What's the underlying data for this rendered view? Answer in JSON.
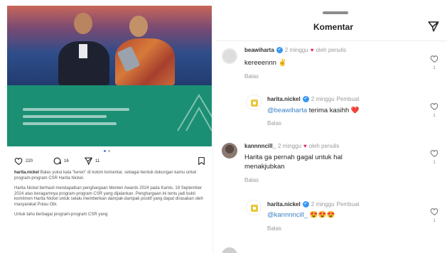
{
  "post": {
    "likes": "220",
    "comments": "16",
    "shares": "11",
    "caption_user": "harita.nickel",
    "caption_line1": "Balas yukui kata \"keren\" di kolom komentar, sebagai bentuk dukungan kamu untuk program-program CSR Harita Nickel.",
    "caption_p2": "Harita Nickel berhasil mendapatkan penghargaan Menteri Awards 2024 pada Kamis, 19 September 2024 atas beragamnya program-program CSR yang dijalankan. Penghargaan ini tentu jadi bukti komitmen Harita Nickel untuk selalu memberikan dampak-dampak positif yang dapat dirasakan oleh masyarakat Pulau Obi.",
    "caption_p3": "Untuk tahu berbagai program-program CSR yang"
  },
  "sheet": {
    "title": "Komentar"
  },
  "comments": [
    {
      "user": "beawiharta",
      "time": "2 minggu",
      "liked_by": "oleh penulis",
      "text": "kereeennn",
      "emoji": "✌️",
      "reply": "Balas",
      "likes": "1"
    },
    {
      "user": "harita.nickel",
      "time": "2 minggu",
      "tag": "Pembuat",
      "mention": "@beawiharta",
      "text": " terima kasihh",
      "emoji": "❤️",
      "reply": "Balas",
      "likes": "1"
    },
    {
      "user": "kannnncill_",
      "time": "2 minggu",
      "liked_by": "oleh penulis",
      "text": "Harita ga pernah gagal untuk hal menakjubkan",
      "reply": "Balas",
      "likes": "1"
    },
    {
      "user": "harita.nickel",
      "time": "2 minggu",
      "tag": "Pembuat",
      "mention": "@kannnncill_",
      "text": " ",
      "emoji": "😍😍😍",
      "reply": "Balas",
      "likes": "1"
    }
  ],
  "icons": {
    "like": "heart-icon",
    "comment": "comment-icon",
    "share": "send-icon",
    "save": "bookmark-icon",
    "verified": "verified-badge-icon"
  },
  "colors": {
    "accent_blue": "#3897f0",
    "heart_red": "#e0245e",
    "panel_green": "#1b8f73"
  }
}
